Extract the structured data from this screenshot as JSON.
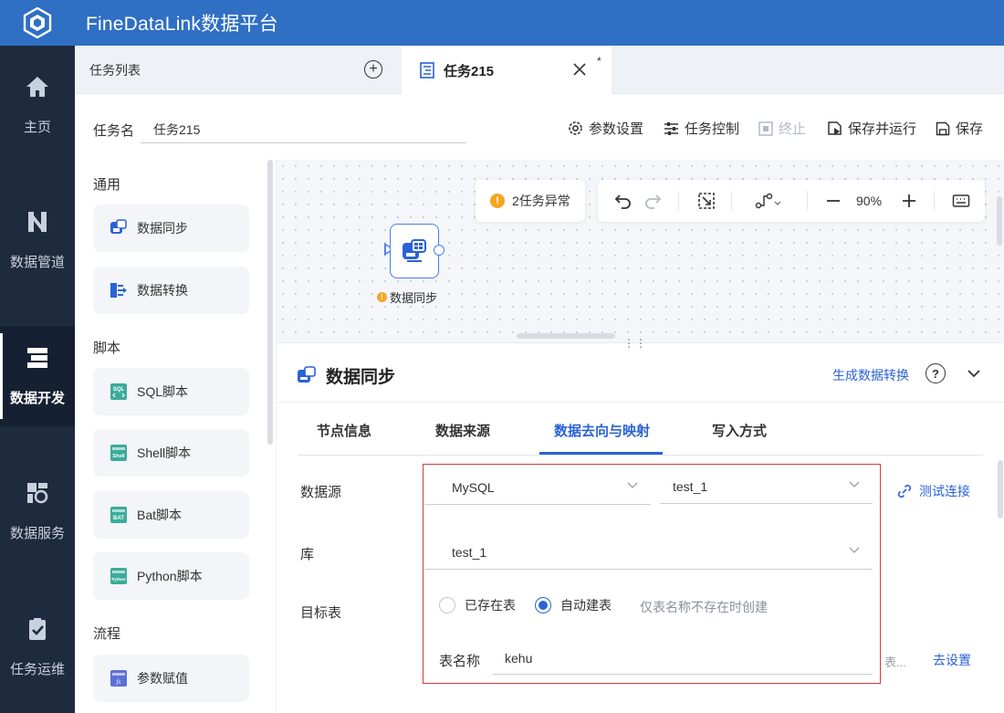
{
  "app": {
    "title": "FineDataLink数据平台"
  },
  "nav": [
    {
      "label": "主页",
      "icon": "home-icon"
    },
    {
      "label": "数据管道",
      "icon": "pipeline-icon"
    },
    {
      "label": "数据开发",
      "icon": "develop-icon",
      "active": true
    },
    {
      "label": "数据服务",
      "icon": "service-icon"
    },
    {
      "label": "任务运维",
      "icon": "ops-icon"
    }
  ],
  "tabs": {
    "list_label": "任务列表",
    "active_title": "任务215",
    "dirty_mark": "*"
  },
  "task": {
    "name_label": "任务名",
    "name_value": "任务215",
    "toolbar": {
      "params": "参数设置",
      "control": "任务控制",
      "stop": "终止",
      "save_run": "保存并运行",
      "save": "保存"
    }
  },
  "palette": {
    "sections": {
      "general": "通用",
      "script": "脚本",
      "flow": "流程"
    },
    "items": {
      "data_sync": "数据同步",
      "data_transform": "数据转换",
      "sql": "SQL脚本",
      "shell": "Shell脚本",
      "bat": "Bat脚本",
      "python": "Python脚本",
      "param_assign": "参数赋值"
    },
    "icon_texts": {
      "sql": "SQL",
      "shell": "Shell",
      "bat": "BAT",
      "python": "Python",
      "fx": "fx"
    }
  },
  "canvas": {
    "alert": "2任务异常",
    "alert_mark": "!",
    "zoom": "90%",
    "node_label": "数据同步",
    "node_warn": "!"
  },
  "panel": {
    "title": "数据同步",
    "link": "生成数据转换",
    "help": "?",
    "drag_handle": "⋮⋮",
    "tabs": [
      "节点信息",
      "数据来源",
      "数据去向与映射",
      "写入方式"
    ],
    "active_tab": 2,
    "form": {
      "datasource_label": "数据源",
      "datasource_type": "MySQL",
      "datasource_conn": "test_1",
      "test_connection": "测试连接",
      "db_label": "库",
      "db_value": "test_1",
      "target_label": "目标表",
      "radio_existing": "已存在表",
      "radio_auto": "自动建表",
      "radio_hint": "仅表名称不存在时创建",
      "table_name_label": "表名称",
      "table_name_value": "kehu",
      "truncated_text": "表...",
      "go_setting": "去设置"
    }
  },
  "colors": {
    "brand": "#2f6fc4",
    "nav_bg": "#1e2a3d",
    "accent": "#2a62d6",
    "warning": "#f5a623",
    "highlight_box": "#d43a3a"
  }
}
